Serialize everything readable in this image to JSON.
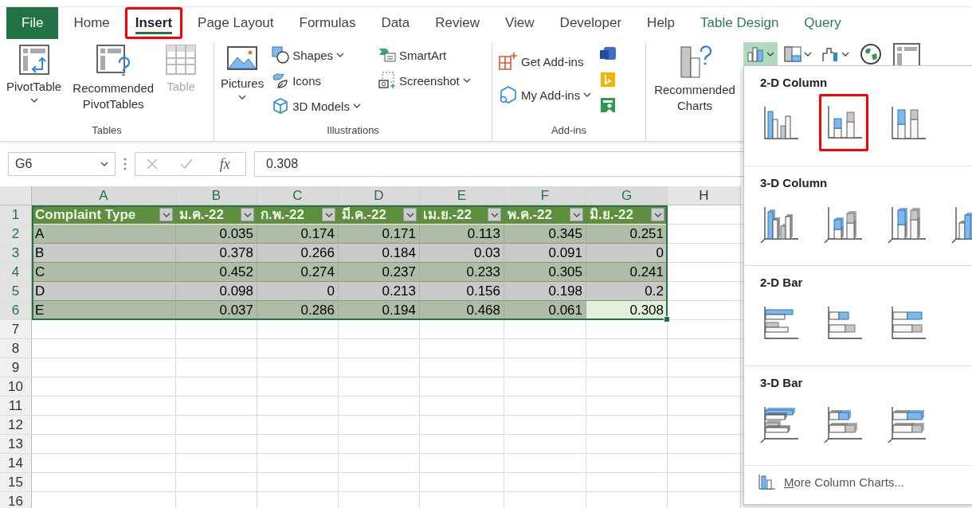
{
  "ribbon_tabs": [
    {
      "label": "File",
      "kind": "file",
      "selected": false,
      "highlighted": false
    },
    {
      "label": "Home",
      "kind": "normal",
      "selected": false,
      "highlighted": false
    },
    {
      "label": "Insert",
      "kind": "normal",
      "selected": true,
      "highlighted": true
    },
    {
      "label": "Page Layout",
      "kind": "normal",
      "selected": false,
      "highlighted": false
    },
    {
      "label": "Formulas",
      "kind": "normal",
      "selected": false,
      "highlighted": false
    },
    {
      "label": "Data",
      "kind": "normal",
      "selected": false,
      "highlighted": false
    },
    {
      "label": "Review",
      "kind": "normal",
      "selected": false,
      "highlighted": false
    },
    {
      "label": "View",
      "kind": "normal",
      "selected": false,
      "highlighted": false
    },
    {
      "label": "Developer",
      "kind": "normal",
      "selected": false,
      "highlighted": false
    },
    {
      "label": "Help",
      "kind": "normal",
      "selected": false,
      "highlighted": false
    },
    {
      "label": "Table Design",
      "kind": "contextual",
      "selected": false,
      "highlighted": false
    },
    {
      "label": "Query",
      "kind": "contextual",
      "selected": false,
      "highlighted": false
    }
  ],
  "ribbon": {
    "tables": {
      "label": "Tables",
      "commands": [
        {
          "label": "PivotTable",
          "dropdown": true,
          "disabled": false
        },
        {
          "label": "Recommended PivotTables",
          "dropdown": false,
          "disabled": false
        },
        {
          "label": "Table",
          "dropdown": false,
          "disabled": true
        }
      ]
    },
    "illustrations": {
      "label": "Illustrations",
      "commands": [
        {
          "label": "Pictures",
          "dropdown": true
        },
        {
          "label": "Shapes",
          "dropdown": true
        },
        {
          "label": "Icons",
          "dropdown": false
        },
        {
          "label": "3D Models",
          "dropdown": true
        },
        {
          "label": "SmartArt",
          "dropdown": false
        },
        {
          "label": "Screenshot",
          "dropdown": true
        }
      ]
    },
    "addins": {
      "label": "Add-ins",
      "commands": [
        {
          "label": "Get Add-ins",
          "dropdown": false
        },
        {
          "label": "My Add-ins",
          "dropdown": true
        }
      ]
    },
    "charts": {
      "recommended": "Recommended Charts",
      "chart_buttons": [
        {
          "selected": true,
          "dropdown": true
        },
        {
          "selected": false,
          "dropdown": true
        },
        {
          "selected": false,
          "dropdown": true
        },
        {
          "selected": false,
          "dropdown": false
        },
        {
          "selected": false,
          "dropdown": false
        }
      ]
    }
  },
  "formula_bar": {
    "name_box": "G6",
    "function_button": "fx",
    "formula": "0.308"
  },
  "sheet": {
    "columns": [
      {
        "label": "A",
        "selected": true
      },
      {
        "label": "B",
        "selected": true
      },
      {
        "label": "C",
        "selected": true
      },
      {
        "label": "D",
        "selected": true
      },
      {
        "label": "E",
        "selected": true
      },
      {
        "label": "F",
        "selected": true
      },
      {
        "label": "G",
        "selected": true
      },
      {
        "label": "H",
        "selected": false
      }
    ],
    "row_numbers": [
      {
        "label": "1",
        "selected": true
      },
      {
        "label": "2",
        "selected": true
      },
      {
        "label": "3",
        "selected": true
      },
      {
        "label": "4",
        "selected": true
      },
      {
        "label": "5",
        "selected": true
      },
      {
        "label": "6",
        "selected": true
      },
      {
        "label": "7",
        "selected": false
      },
      {
        "label": "8",
        "selected": false
      },
      {
        "label": "9",
        "selected": false
      },
      {
        "label": "10",
        "selected": false
      },
      {
        "label": "11",
        "selected": false
      },
      {
        "label": "12",
        "selected": false
      },
      {
        "label": "13",
        "selected": false
      },
      {
        "label": "14",
        "selected": false
      },
      {
        "label": "15",
        "selected": false
      },
      {
        "label": "16",
        "selected": false
      }
    ],
    "table": {
      "headers": [
        "Complaint Type",
        "ม.ค.-22",
        "ก.พ.-22",
        "มี.ค.-22",
        "เม.ย.-22",
        "พ.ค.-22",
        "มิ.ย.-22"
      ],
      "rows": [
        {
          "cells": [
            {
              "text": "A",
              "active": false
            },
            {
              "text": "0.035",
              "active": false
            },
            {
              "text": "0.174",
              "active": false
            },
            {
              "text": "0.171",
              "active": false
            },
            {
              "text": "0.113",
              "active": false
            },
            {
              "text": "0.345",
              "active": false
            },
            {
              "text": "0.251",
              "active": false
            }
          ]
        },
        {
          "cells": [
            {
              "text": "B",
              "active": false
            },
            {
              "text": "0.378",
              "active": false
            },
            {
              "text": "0.266",
              "active": false
            },
            {
              "text": "0.184",
              "active": false
            },
            {
              "text": "0.03",
              "active": false
            },
            {
              "text": "0.091",
              "active": false
            },
            {
              "text": "0",
              "active": false
            }
          ]
        },
        {
          "cells": [
            {
              "text": "C",
              "active": false
            },
            {
              "text": "0.452",
              "active": false
            },
            {
              "text": "0.274",
              "active": false
            },
            {
              "text": "0.237",
              "active": false
            },
            {
              "text": "0.233",
              "active": false
            },
            {
              "text": "0.305",
              "active": false
            },
            {
              "text": "0.241",
              "active": false
            }
          ]
        },
        {
          "cells": [
            {
              "text": "D",
              "active": false
            },
            {
              "text": "0.098",
              "active": false
            },
            {
              "text": "0",
              "active": false
            },
            {
              "text": "0.213",
              "active": false
            },
            {
              "text": "0.156",
              "active": false
            },
            {
              "text": "0.198",
              "active": false
            },
            {
              "text": "0.2",
              "active": false
            }
          ]
        },
        {
          "cells": [
            {
              "text": "E",
              "active": false
            },
            {
              "text": "0.037",
              "active": false
            },
            {
              "text": "0.286",
              "active": false
            },
            {
              "text": "0.194",
              "active": false
            },
            {
              "text": "0.468",
              "active": false
            },
            {
              "text": "0.061",
              "active": false
            },
            {
              "text": "0.308",
              "active": true
            }
          ]
        }
      ]
    }
  },
  "chart_menu": {
    "sections": [
      {
        "title": "2-D Column",
        "kind": "column",
        "three_d": false,
        "charts": [
          {
            "kind": "clustered",
            "highlighted": false
          },
          {
            "kind": "stacked",
            "highlighted": true
          },
          {
            "kind": "stacked100",
            "highlighted": false
          }
        ]
      },
      {
        "title": "3-D Column",
        "kind": "column",
        "three_d": true,
        "charts": [
          {
            "kind": "clustered",
            "highlighted": false
          },
          {
            "kind": "stacked",
            "highlighted": false
          },
          {
            "kind": "stacked100",
            "highlighted": false
          },
          {
            "kind": "depth",
            "highlighted": false
          }
        ]
      },
      {
        "title": "2-D Bar",
        "kind": "bar",
        "three_d": false,
        "charts": [
          {
            "kind": "clustered",
            "highlighted": false
          },
          {
            "kind": "stacked",
            "highlighted": false
          },
          {
            "kind": "stacked100",
            "highlighted": false
          }
        ]
      },
      {
        "title": "3-D Bar",
        "kind": "bar",
        "three_d": true,
        "charts": [
          {
            "kind": "clustered",
            "highlighted": false
          },
          {
            "kind": "stacked",
            "highlighted": false
          },
          {
            "kind": "stacked100",
            "highlighted": false
          }
        ]
      }
    ],
    "more_link": "More Column Charts..."
  }
}
